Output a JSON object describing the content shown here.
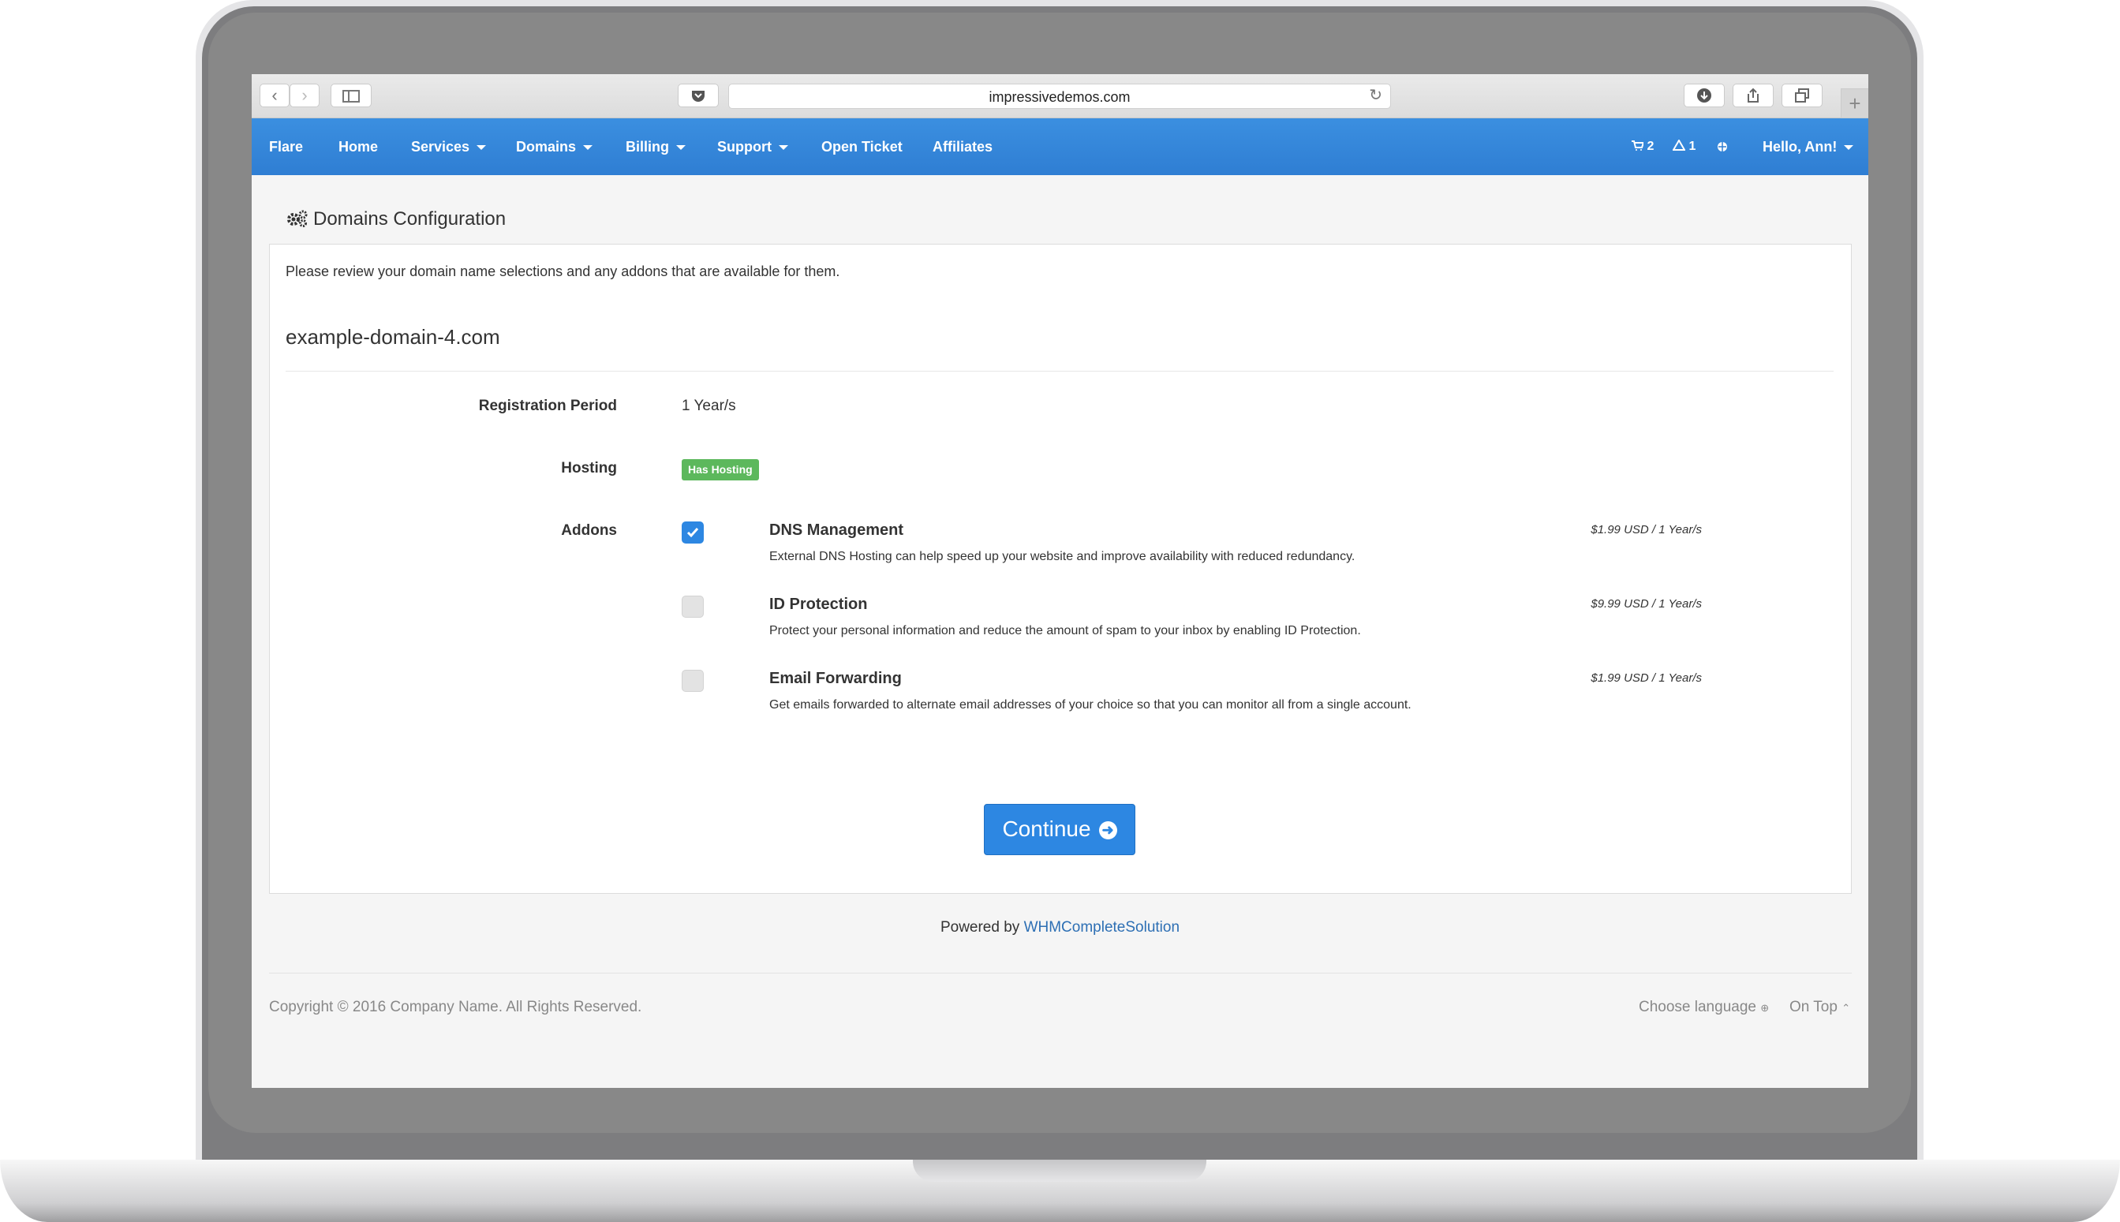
{
  "browser": {
    "url": "impressivedemos.com"
  },
  "nav": {
    "brand": "Flare",
    "items": [
      {
        "label": "Home"
      },
      {
        "label": "Services"
      },
      {
        "label": "Domains"
      },
      {
        "label": "Billing"
      },
      {
        "label": "Support"
      },
      {
        "label": "Open Ticket"
      },
      {
        "label": "Affiliates"
      }
    ],
    "cart_count": "2",
    "alerts_count": "1",
    "user_greeting": "Hello, Ann!"
  },
  "page": {
    "title": "Domains Configuration",
    "intro": "Please review your domain name selections and any addons that are available for them.",
    "domain": "example-domain-4.com",
    "registration_period_label": "Registration Period",
    "registration_period_value": "1 Year/s",
    "hosting_label": "Hosting",
    "hosting_badge": "Has Hosting",
    "addons_label": "Addons",
    "addons": [
      {
        "name": "DNS Management",
        "description": "External DNS Hosting can help speed up your website and improve availability with reduced redundancy.",
        "price": "$1.99 USD / 1 Year/s",
        "checked": true
      },
      {
        "name": "ID Protection",
        "description": "Protect your personal information and reduce the amount of spam to your inbox by enabling ID Protection.",
        "price": "$9.99 USD / 1 Year/s",
        "checked": false
      },
      {
        "name": "Email Forwarding",
        "description": "Get emails forwarded to alternate email addresses of your choice so that you can monitor all from a single account.",
        "price": "$1.99 USD / 1 Year/s",
        "checked": false
      }
    ],
    "continue_label": "Continue"
  },
  "footer": {
    "powered_prefix": "Powered by",
    "powered_link": "WHMCompleteSolution",
    "copyright": "Copyright © 2016 Company Name. All Rights Reserved.",
    "choose_language": "Choose language",
    "on_top": "On Top"
  },
  "colors": {
    "nav": "#2f7ed3",
    "accent": "#2d87e2",
    "badge": "#5cb85c"
  }
}
